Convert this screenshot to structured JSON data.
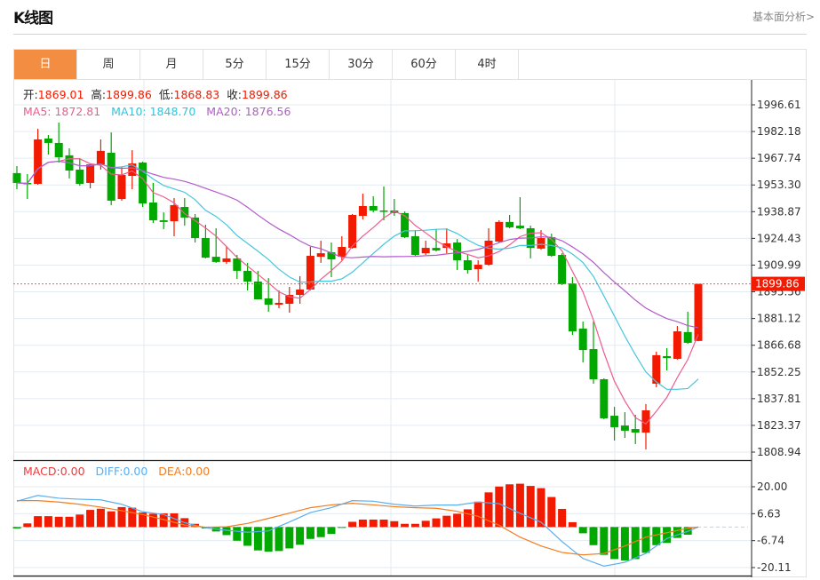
{
  "header": {
    "title": "K线图",
    "link": "基本面分析>"
  },
  "tabs": [
    {
      "label": "日",
      "active": true
    },
    {
      "label": "周"
    },
    {
      "label": "月"
    },
    {
      "label": "5分"
    },
    {
      "label": "15分"
    },
    {
      "label": "30分"
    },
    {
      "label": "60分"
    },
    {
      "label": "4时"
    }
  ],
  "legend": {
    "open_label": "开:",
    "open": "1869.01",
    "high_label": "高:",
    "high": "1899.86",
    "low_label": "低:",
    "low": "1868.83",
    "close_label": "收:",
    "close": "1899.86",
    "ma5_label": "MA5: ",
    "ma5": "1872.81",
    "ma10_label": "MA10: ",
    "ma10": "1848.70",
    "ma20_label": "MA20: ",
    "ma20": "1876.56",
    "macd_label": "MACD:",
    "macd": "0.00",
    "diff_label": "DIFF:",
    "diff": "0.00",
    "dea_label": "DEA:",
    "dea": "0.00"
  },
  "colors": {
    "up": "#F21A00",
    "down": "#00A800",
    "ma5": "#EE5C8E",
    "ma10": "#45C6DE",
    "ma20": "#B45BCB",
    "diff": "#5AAEF0",
    "dea": "#F57C1F",
    "accent": "#F28D41"
  },
  "chart_data": {
    "type": "candlestick",
    "price_axis": {
      "ticks": [
        "1996.61",
        "1982.18",
        "1967.74",
        "1953.30",
        "1938.87",
        "1924.43",
        "1909.99",
        "1895.56",
        "1881.12",
        "1866.68",
        "1852.25",
        "1837.81",
        "1823.37",
        "1808.94"
      ],
      "range": [
        1808.94,
        1996.61
      ]
    },
    "last_price": "1899.86",
    "ohlc": [
      [
        1959.7,
        1963.5,
        1951.0,
        1954.4
      ],
      [
        1954.4,
        1959.2,
        1945.7,
        1953.9
      ],
      [
        1953.9,
        1983.7,
        1953.4,
        1977.9
      ],
      [
        1978.4,
        1980.3,
        1969.7,
        1976.0
      ],
      [
        1976.0,
        1987.0,
        1965.4,
        1968.3
      ],
      [
        1969.3,
        1973.1,
        1956.8,
        1961.1
      ],
      [
        1961.6,
        1967.8,
        1952.9,
        1953.9
      ],
      [
        1954.4,
        1964.4,
        1951.5,
        1964.4
      ],
      [
        1964.4,
        1977.9,
        1961.6,
        1971.7
      ],
      [
        1970.7,
        1981.7,
        1942.4,
        1944.8
      ],
      [
        1945.7,
        1963.0,
        1944.8,
        1958.7
      ],
      [
        1958.2,
        1972.1,
        1951.0,
        1964.9
      ],
      [
        1965.4,
        1965.9,
        1941.4,
        1943.3
      ],
      [
        1943.8,
        1954.4,
        1932.8,
        1934.2
      ],
      [
        1934.2,
        1938.5,
        1929.4,
        1933.3
      ],
      [
        1933.7,
        1946.2,
        1925.6,
        1942.4
      ],
      [
        1941.4,
        1946.2,
        1931.3,
        1935.7
      ],
      [
        1935.7,
        1937.6,
        1922.2,
        1924.6
      ],
      [
        1924.6,
        1931.8,
        1913.6,
        1914.0
      ],
      [
        1914.5,
        1929.9,
        1911.2,
        1911.7
      ],
      [
        1911.7,
        1920.3,
        1910.7,
        1913.6
      ],
      [
        1913.6,
        1915.5,
        1902.5,
        1906.9
      ],
      [
        1906.9,
        1911.2,
        1896.3,
        1901.1
      ],
      [
        1901.1,
        1906.9,
        1891.5,
        1891.5
      ],
      [
        1892.0,
        1903.0,
        1884.8,
        1888.6
      ],
      [
        1888.6,
        1896.3,
        1886.7,
        1889.6
      ],
      [
        1889.1,
        1898.2,
        1884.3,
        1893.9
      ],
      [
        1893.9,
        1904.0,
        1889.1,
        1896.8
      ],
      [
        1896.8,
        1919.8,
        1896.3,
        1915.0
      ],
      [
        1914.5,
        1923.2,
        1911.2,
        1916.4
      ],
      [
        1916.9,
        1922.2,
        1903.5,
        1913.1
      ],
      [
        1914.5,
        1925.6,
        1912.6,
        1919.8
      ],
      [
        1919.3,
        1937.6,
        1918.9,
        1937.1
      ],
      [
        1936.6,
        1948.6,
        1934.7,
        1941.9
      ],
      [
        1941.9,
        1947.2,
        1938.5,
        1939.5
      ],
      [
        1939.5,
        1952.5,
        1934.2,
        1939.0
      ],
      [
        1939.5,
        1945.7,
        1936.6,
        1938.1
      ],
      [
        1938.1,
        1939.0,
        1924.6,
        1925.1
      ],
      [
        1925.6,
        1928.9,
        1915.0,
        1915.5
      ],
      [
        1916.4,
        1923.2,
        1915.5,
        1919.3
      ],
      [
        1919.3,
        1929.4,
        1917.4,
        1917.9
      ],
      [
        1919.3,
        1929.9,
        1916.4,
        1921.7
      ],
      [
        1922.2,
        1924.1,
        1907.3,
        1912.6
      ],
      [
        1912.6,
        1915.5,
        1905.4,
        1907.3
      ],
      [
        1907.8,
        1912.6,
        1901.1,
        1910.2
      ],
      [
        1910.2,
        1929.9,
        1909.7,
        1923.2
      ],
      [
        1922.7,
        1934.2,
        1922.2,
        1933.3
      ],
      [
        1933.3,
        1937.1,
        1929.9,
        1930.4
      ],
      [
        1931.3,
        1946.7,
        1929.4,
        1929.9
      ],
      [
        1929.9,
        1931.3,
        1913.6,
        1919.3
      ],
      [
        1918.9,
        1928.9,
        1918.4,
        1924.6
      ],
      [
        1925.1,
        1927.0,
        1914.5,
        1915.0
      ],
      [
        1915.5,
        1916.4,
        1899.2,
        1899.7
      ],
      [
        1900.1,
        1903.5,
        1872.3,
        1874.2
      ],
      [
        1875.7,
        1879.5,
        1857.4,
        1864.1
      ],
      [
        1864.6,
        1879.5,
        1845.9,
        1848.3
      ],
      [
        1848.3,
        1848.8,
        1826.7,
        1827.2
      ],
      [
        1828.6,
        1833.4,
        1815.2,
        1822.4
      ],
      [
        1823.3,
        1830.5,
        1816.6,
        1820.5
      ],
      [
        1821.4,
        1829.1,
        1813.3,
        1819.5
      ],
      [
        1819.5,
        1834.9,
        1810.4,
        1831.5
      ],
      [
        1845.9,
        1863.2,
        1844.0,
        1861.3
      ],
      [
        1860.8,
        1865.1,
        1853.1,
        1859.8
      ],
      [
        1859.3,
        1877.1,
        1858.9,
        1874.2
      ],
      [
        1873.8,
        1884.8,
        1867.5,
        1868.0
      ],
      [
        1869.01,
        1899.86,
        1868.83,
        1899.86
      ]
    ],
    "moving_averages": [
      "MA5",
      "MA10",
      "MA20"
    ],
    "macd_axis": {
      "ticks": [
        "20.00",
        "6.63",
        "-6.74",
        "-20.11"
      ],
      "range": [
        -20.11,
        20.0
      ]
    },
    "macd_hist": [
      -0.7,
      1.8,
      5.4,
      5.4,
      5.1,
      5.1,
      6.2,
      8.5,
      9.1,
      7.8,
      9.9,
      9.6,
      7.2,
      6.6,
      6.8,
      6.8,
      4.4,
      1.6,
      -0.7,
      -2.2,
      -4.0,
      -6.8,
      -9.3,
      -11.6,
      -12.2,
      -11.9,
      -10.6,
      -8.8,
      -5.9,
      -5.0,
      -3.4,
      -0.4,
      2.6,
      3.7,
      3.7,
      3.7,
      2.9,
      1.6,
      1.6,
      3.1,
      4.3,
      5.6,
      6.6,
      8.8,
      12.6,
      17.2,
      20.1,
      21.2,
      21.5,
      20.4,
      19.3,
      14.9,
      9.0,
      2.4,
      -3.1,
      -9.0,
      -13.8,
      -15.9,
      -16.6,
      -15.9,
      -12.8,
      -9.0,
      -7.9,
      -5.4,
      -3.8,
      0.0
    ],
    "diff": [
      [
        1,
        12.8
      ],
      [
        3,
        15.7
      ],
      [
        5,
        14.3
      ],
      [
        7,
        13.8
      ],
      [
        9,
        13.5
      ],
      [
        11,
        11.3
      ],
      [
        13,
        7.6
      ],
      [
        15,
        6.2
      ],
      [
        17,
        2.2
      ],
      [
        19,
        -0.4
      ],
      [
        21,
        -1.6
      ],
      [
        23,
        -2.6
      ],
      [
        25,
        -1.9
      ],
      [
        27,
        2.5
      ],
      [
        29,
        7.2
      ],
      [
        31,
        9.6
      ],
      [
        33,
        13.1
      ],
      [
        35,
        12.8
      ],
      [
        37,
        11.3
      ],
      [
        39,
        10.4
      ],
      [
        41,
        10.9
      ],
      [
        43,
        10.9
      ],
      [
        45,
        12.4
      ],
      [
        47,
        11.6
      ],
      [
        49,
        6.8
      ],
      [
        51,
        2.4
      ],
      [
        53,
        -7.2
      ],
      [
        55,
        -15.6
      ],
      [
        57,
        -19.4
      ],
      [
        59,
        -17.5
      ],
      [
        61,
        -13.1
      ],
      [
        63,
        -5.7
      ],
      [
        65,
        -2.1
      ],
      [
        66,
        0.0
      ]
    ],
    "dea": [
      [
        1,
        13.1
      ],
      [
        3,
        13.1
      ],
      [
        5,
        12.4
      ],
      [
        7,
        11.3
      ],
      [
        9,
        9.9
      ],
      [
        11,
        8.1
      ],
      [
        13,
        6.2
      ],
      [
        15,
        3.7
      ],
      [
        17,
        1.0
      ],
      [
        19,
        -0.1
      ],
      [
        21,
        0.1
      ],
      [
        23,
        1.8
      ],
      [
        25,
        4.3
      ],
      [
        27,
        6.9
      ],
      [
        29,
        9.6
      ],
      [
        31,
        11.0
      ],
      [
        33,
        11.8
      ],
      [
        35,
        11.0
      ],
      [
        37,
        10.1
      ],
      [
        39,
        9.6
      ],
      [
        41,
        9.3
      ],
      [
        43,
        7.8
      ],
      [
        45,
        5.3
      ],
      [
        47,
        0.9
      ],
      [
        49,
        -5.0
      ],
      [
        51,
        -9.4
      ],
      [
        53,
        -12.6
      ],
      [
        55,
        -13.8
      ],
      [
        57,
        -13.1
      ],
      [
        59,
        -9.4
      ],
      [
        61,
        -5.0
      ],
      [
        63,
        -2.8
      ],
      [
        65,
        -0.6
      ],
      [
        66,
        0.0
      ]
    ]
  }
}
